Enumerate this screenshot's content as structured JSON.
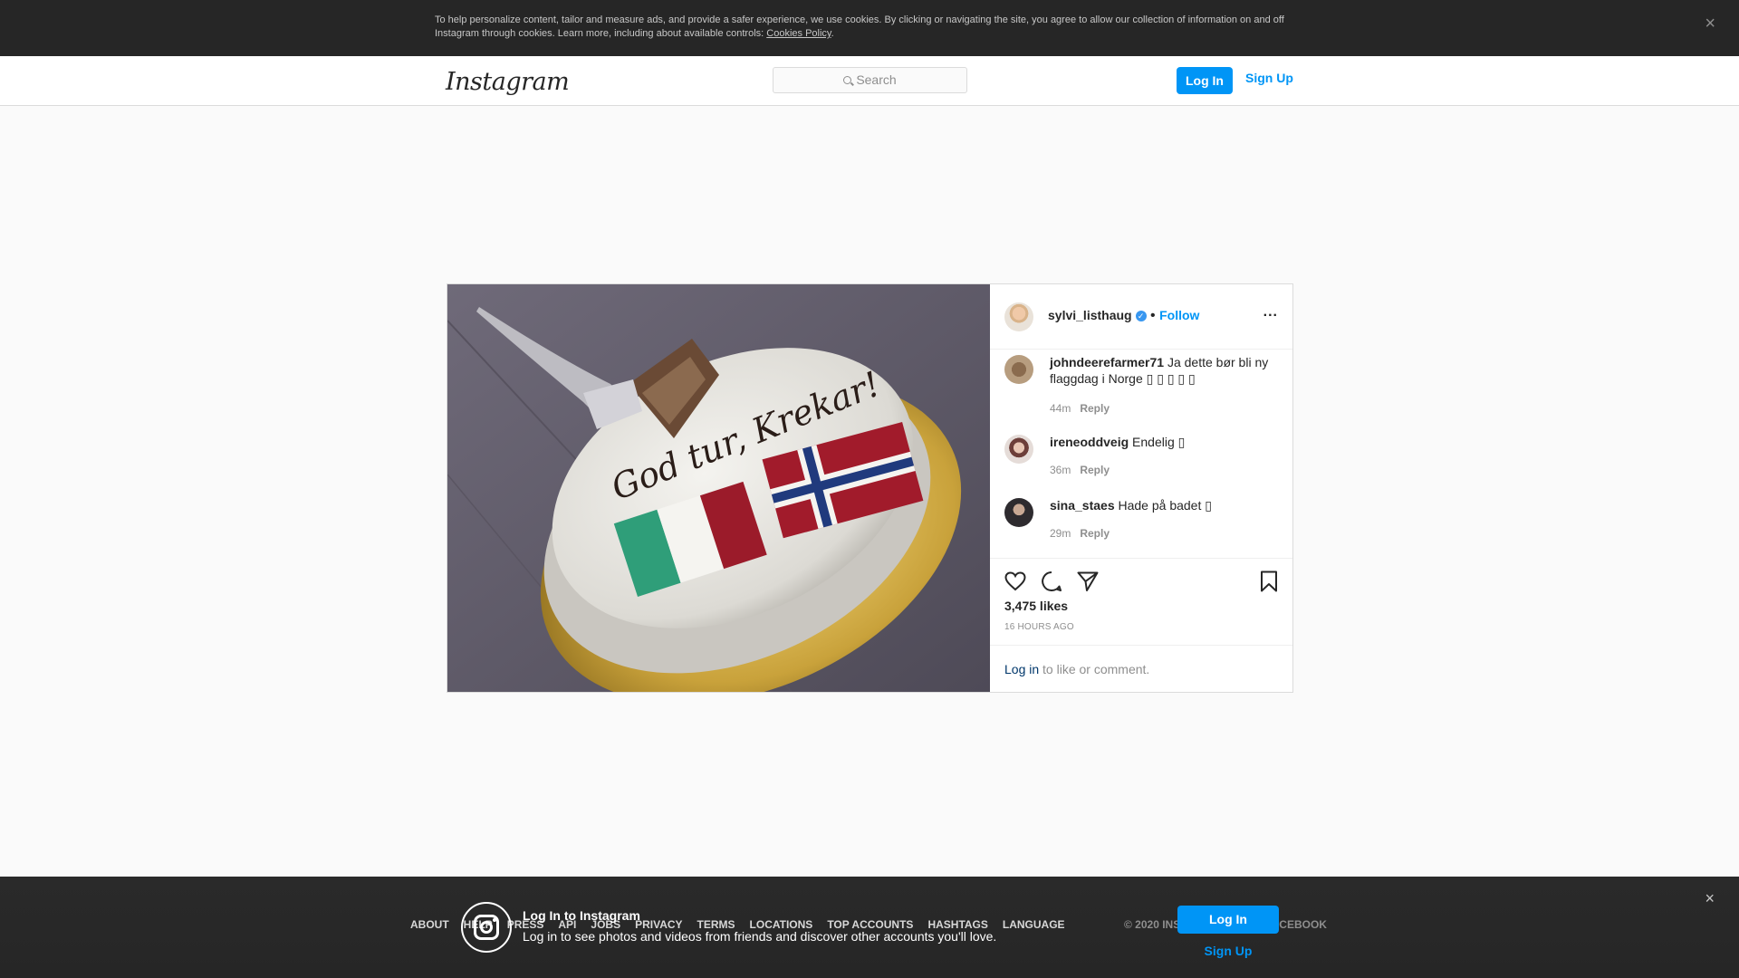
{
  "cookie_banner": {
    "text": "To help personalize content, tailor and measure ads, and provide a safer experience, we use cookies. By clicking or navigating the site, you agree to allow our collection of information on and off Instagram through cookies. Learn more, including about available controls: ",
    "link": "Cookies Policy",
    "close": "×"
  },
  "nav": {
    "logo": "Instagram",
    "search_placeholder": "Search",
    "login": "Log In",
    "signup": "Sign Up"
  },
  "post": {
    "username": "sylvi_listhaug",
    "verified_mark": "✓",
    "separator": "•",
    "follow": "Follow",
    "more": "...",
    "photo_text": "God tur, Krekar!",
    "comments": [
      {
        "user": "johndeerefarmer71",
        "text": "Ja dette bør bli ny flaggdag i Norge ▯ ▯ ▯ ▯ ▯",
        "time": "44m",
        "reply": "Reply"
      },
      {
        "user": "ireneoddveig",
        "text": "Endelig ▯",
        "time": "36m",
        "reply": "Reply"
      },
      {
        "user": "sina_staes",
        "text": "Hade på badet ▯",
        "time": "29m",
        "reply": "Reply"
      }
    ],
    "likes": "3,475 likes",
    "time_ago": "16 HOURS AGO",
    "login_link": "Log in",
    "login_text": " to like or comment."
  },
  "footer": {
    "links": [
      "ABOUT",
      "HELP",
      "PRESS",
      "API",
      "JOBS",
      "PRIVACY",
      "TERMS",
      "LOCATIONS",
      "TOP ACCOUNTS",
      "HASHTAGS",
      "LANGUAGE"
    ],
    "copyright": "© 2020 INSTAGRAM FROM FACEBOOK"
  },
  "bottom_bar": {
    "title": "Log In to Instagram",
    "subtitle": "Log in to see photos and videos from friends and discover other accounts you'll love.",
    "login": "Log In",
    "signup": "Sign Up",
    "close": "×"
  }
}
